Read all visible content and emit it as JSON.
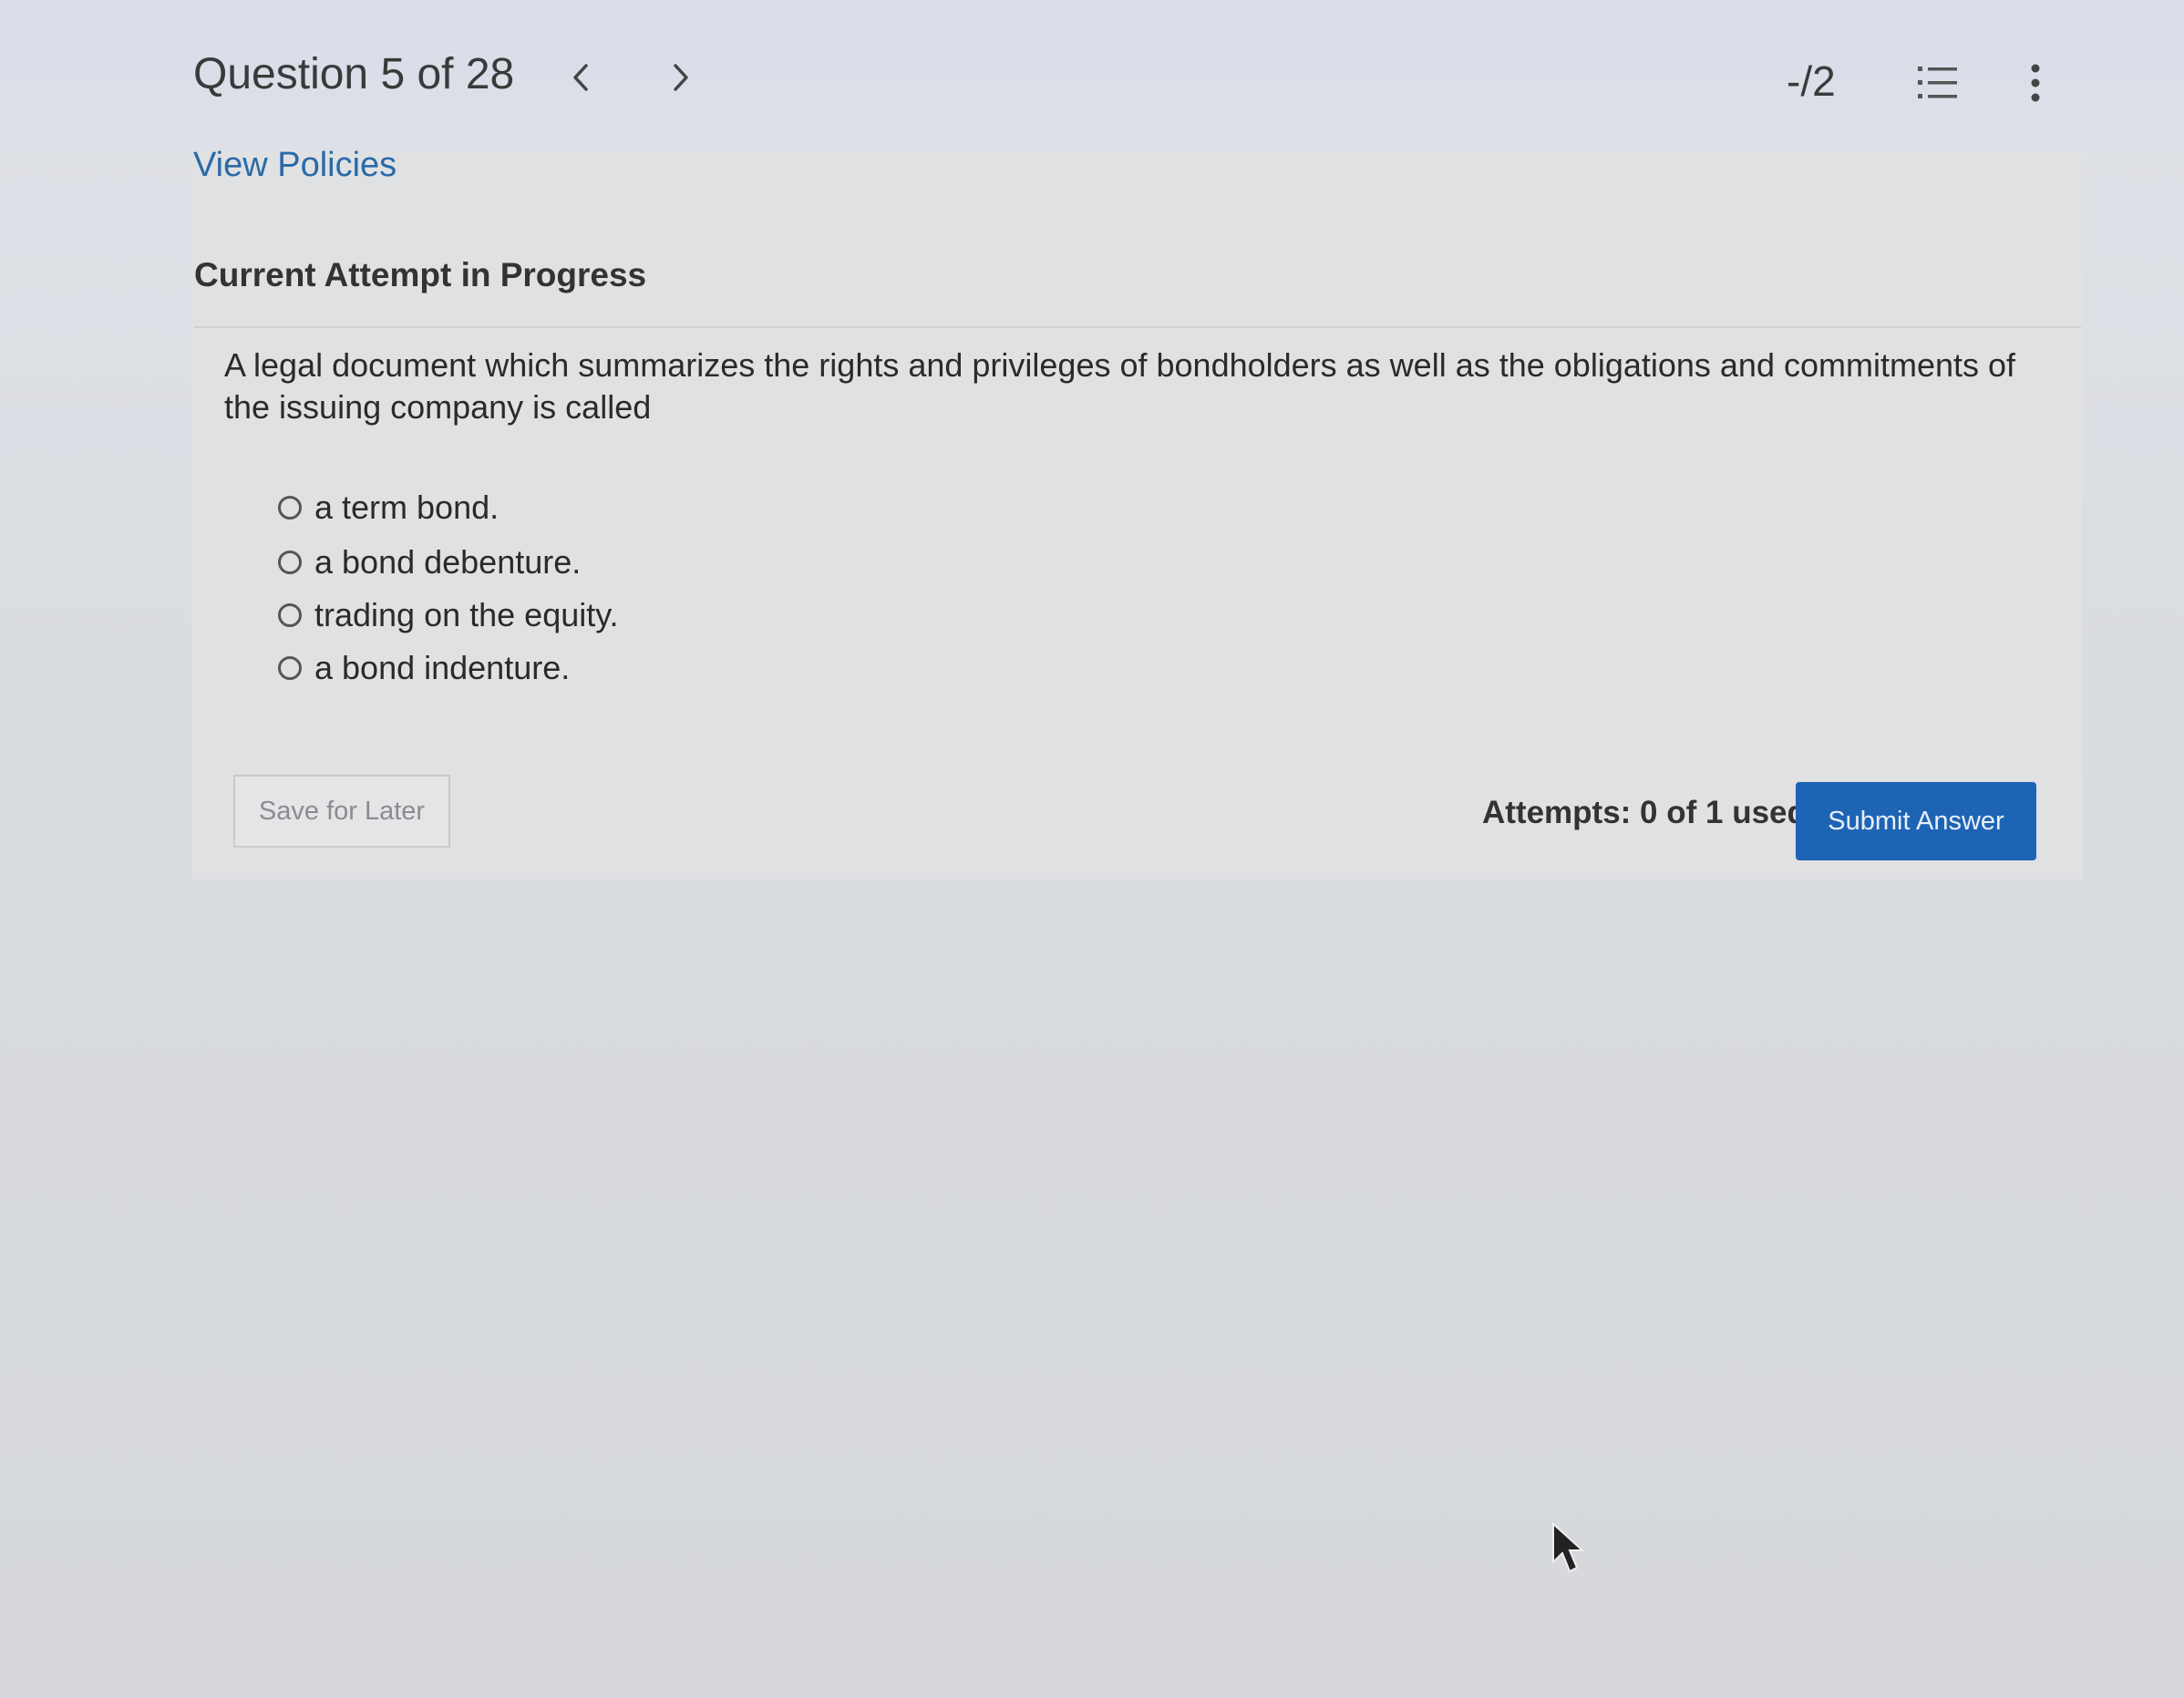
{
  "header": {
    "question_counter": "Question 5 of 28",
    "prev_icon": "chevron-left-icon",
    "next_icon": "chevron-right-icon",
    "score": "-/2",
    "list_icon": "numbered-list-icon",
    "more_icon": "vertical-ellipsis-icon"
  },
  "policies": {
    "link_label": "View Policies"
  },
  "attempt": {
    "status": "Current Attempt in Progress"
  },
  "question": {
    "text": "A legal document which summarizes the rights and privileges of bondholders as well as the obligations and commitments of the issuing company is called",
    "options": [
      {
        "label": "a term bond.",
        "selected": false
      },
      {
        "label": "a bond debenture.",
        "selected": false
      },
      {
        "label": "trading on the equity.",
        "selected": false
      },
      {
        "label": "a bond indenture.",
        "selected": false
      }
    ]
  },
  "footer": {
    "save_label": "Save for Later",
    "attempts_text": "Attempts: 0 of 1 used",
    "submit_label": "Submit Answer"
  },
  "colors": {
    "link": "#2a6aa7",
    "submit_bg": "#1d64b5",
    "page_bg": "#e0e1e3"
  }
}
